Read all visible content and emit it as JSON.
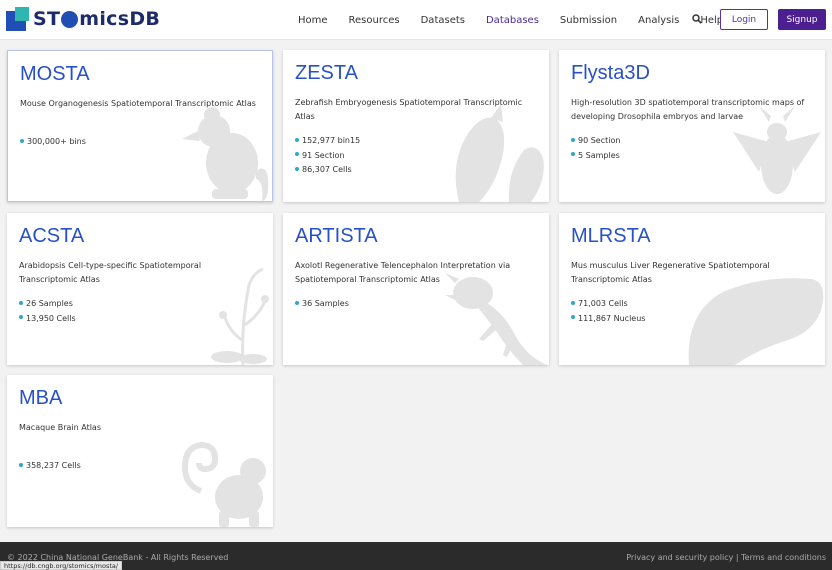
{
  "brand": {
    "logo_left": "ST",
    "logo_right": "micsDB"
  },
  "nav": {
    "links": [
      "Home",
      "Resources",
      "Datasets",
      "Databases",
      "Submission",
      "Analysis",
      "Help"
    ],
    "active": "Databases",
    "search_icon": "search-icon",
    "login_label": "Login",
    "signup_label": "Signup"
  },
  "colors": {
    "title_blue": "#2850c8",
    "brand_purple": "#4b1f8f",
    "bullet": "#2fa7c8"
  },
  "cards": [
    {
      "title": "MOSTA",
      "desc": "Mouse Organogenesis Spatiotemporal Transcriptomic Atlas",
      "stats": [
        "300,000+ bins"
      ],
      "icon": "mouse-icon"
    },
    {
      "title": "ZESTA",
      "desc": "Zebrafish Embryogenesis Spatiotemporal Transcriptomic Atlas",
      "stats": [
        "152,977 bin15",
        "91 Section",
        "86,307 Cells"
      ],
      "icon": "zebrafish-icon"
    },
    {
      "title": "Flysta3D",
      "desc": "High-resolution 3D spatiotemporal transcriptomic maps of developing Drosophila embryos and larvae",
      "stats": [
        "90 Section",
        "5 Samples"
      ],
      "icon": "fly-icon"
    },
    {
      "title": "ACSTA",
      "desc": "Arabidopsis Cell-type-specific Spatiotemporal Transcriptomic Atlas",
      "stats": [
        "26 Samples",
        "13,950 Cells"
      ],
      "icon": "plant-icon"
    },
    {
      "title": "ARTISTA",
      "desc": "Axolotl Regenerative Telencephalon Interpretation via Spatiotemporal Transcriptomic Atlas",
      "stats": [
        "36 Samples"
      ],
      "icon": "axolotl-icon"
    },
    {
      "title": "MLRSTA",
      "desc": "Mus musculus Liver Regenerative Spatiotemporal Transcriptomic Atlas",
      "stats": [
        "71,003 Cells",
        "111,867 Nucleus"
      ],
      "icon": "liver-icon"
    },
    {
      "title": "MBA",
      "desc": "Macaque Brain Atlas",
      "stats": [
        "358,237 Cells"
      ],
      "icon": "monkey-icon"
    }
  ],
  "footer": {
    "copyright": "© 2022 China National GeneBank - All Rights Reserved",
    "privacy": "Privacy and security policy",
    "separator": "|",
    "terms": "Terms and conditions"
  },
  "status_url": "https://db.cngb.org/stomics/mosta/"
}
